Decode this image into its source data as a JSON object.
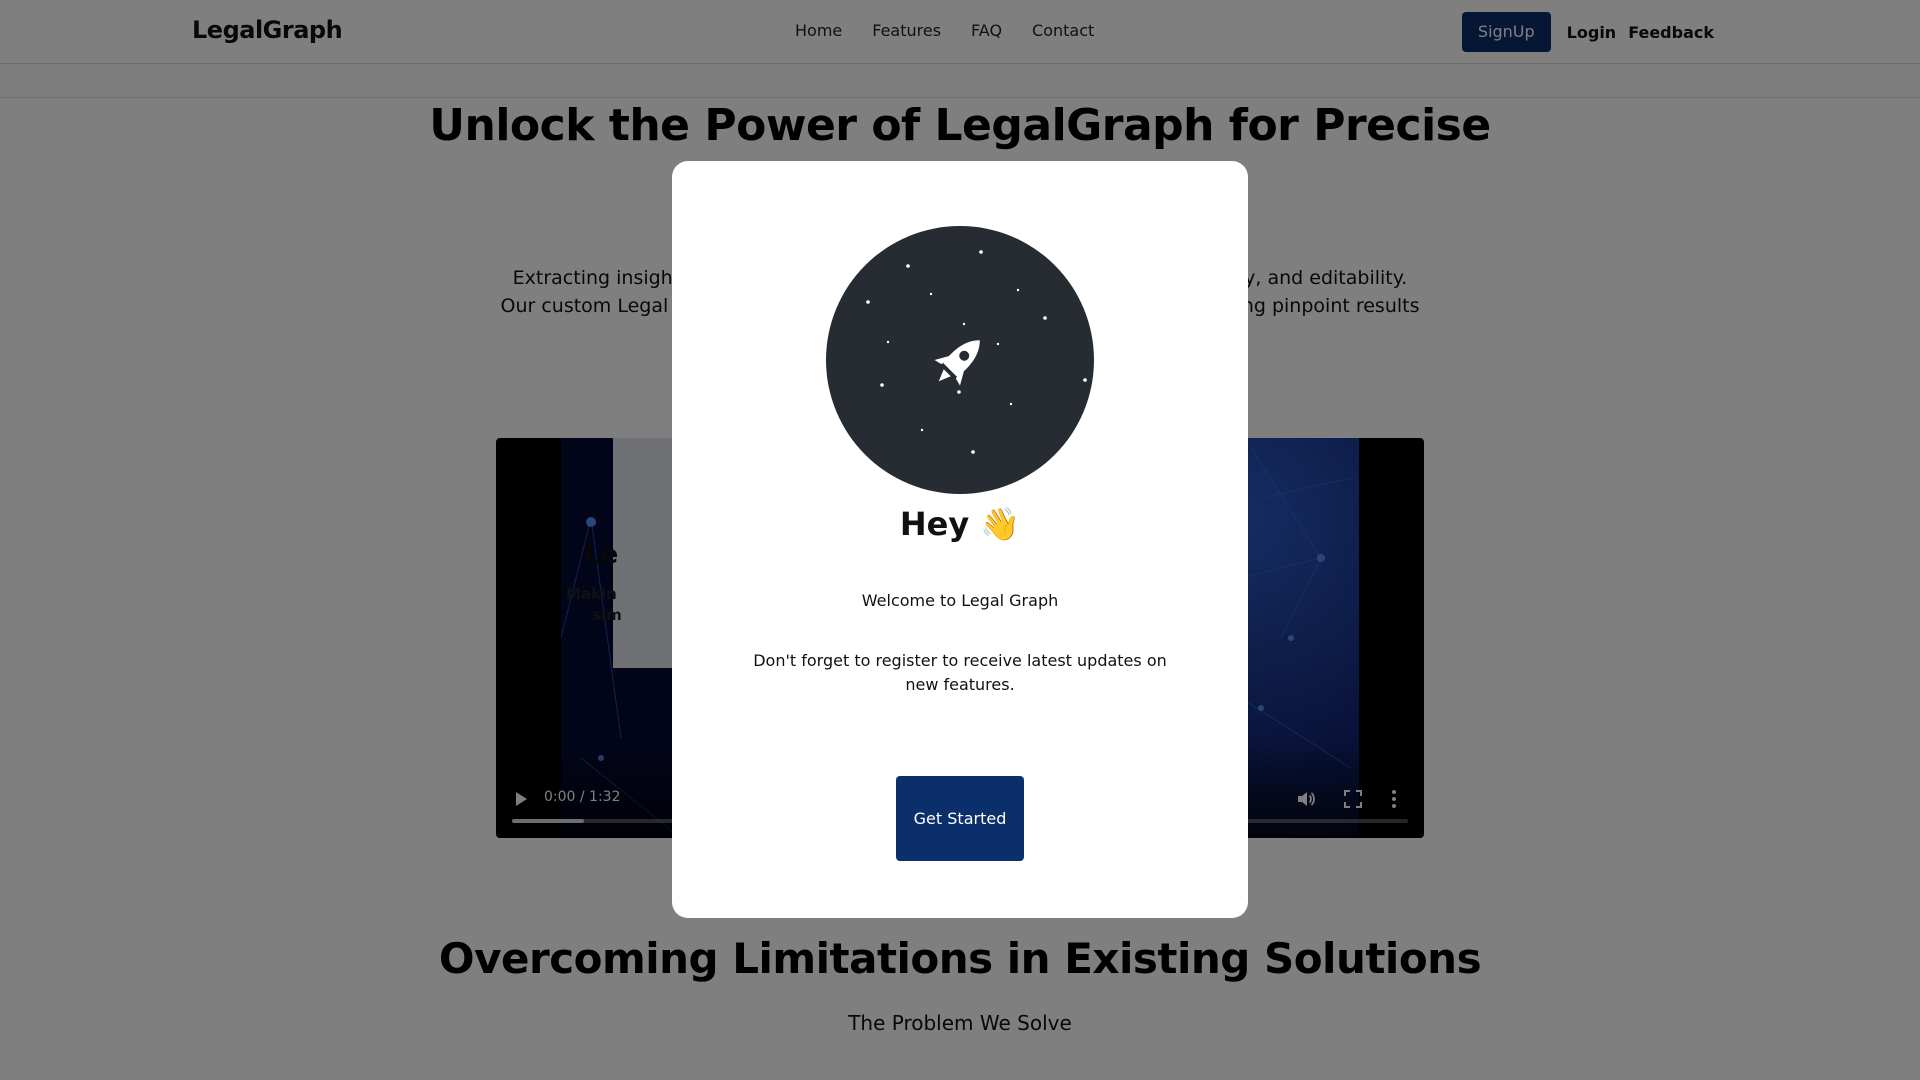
{
  "navbar": {
    "brand": "LegalGraph",
    "links": [
      "Home",
      "Features",
      "FAQ",
      "Contact"
    ],
    "signup_label": "SignUp",
    "login_label": "Login",
    "feedback_label": "Feedback",
    "accent_color": "#0b2f6b"
  },
  "hero": {
    "title": "Unlock the Power of LegalGraph for Precise",
    "description_line1_left": "Extracting insights",
    "description_line1_right": "acy, and editability.",
    "description_line2_left": "Our custom Legal La",
    "description_line2_right": "ing pinpoint results"
  },
  "video": {
    "panel_title": "Le",
    "panel_text_line1": "Makin",
    "panel_text_line2": "sim",
    "time": "0:00 / 1:32",
    "progress_fraction": 0.08
  },
  "section": {
    "title": "Overcoming Limitations in Existing Solutions",
    "subtitle": "The Problem We Solve"
  },
  "modal": {
    "greeting": "Hey 👋",
    "welcome": "Welcome to Legal Graph",
    "message": "Don't forget to register to receive latest updates on new features.",
    "cta_label": "Get Started",
    "illustration": "rocket-icon",
    "circle_color": "#272c33"
  }
}
